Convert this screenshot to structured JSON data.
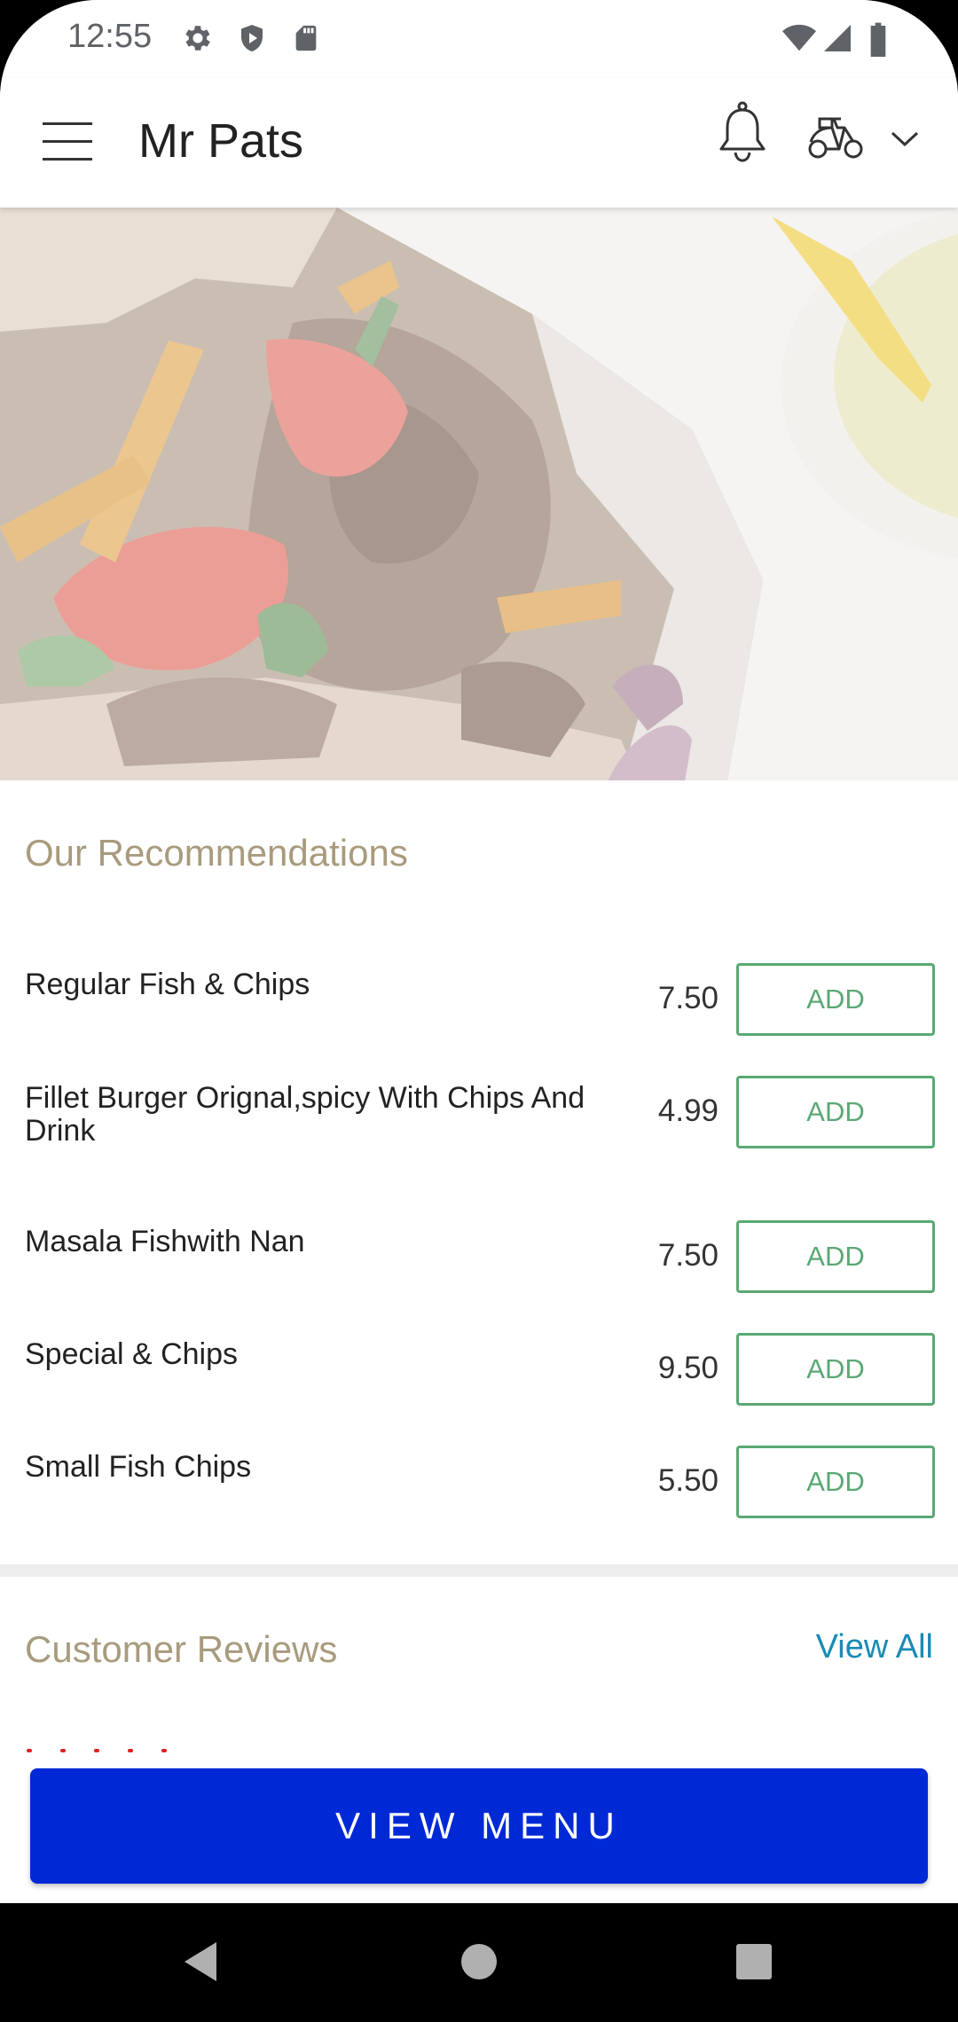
{
  "status_bar": {
    "time": "12:55",
    "icons_left": [
      "gear-icon",
      "shield-icon",
      "sd-card-icon"
    ],
    "icons_right": [
      "wifi-icon",
      "cell-signal-icon",
      "battery-icon"
    ]
  },
  "app_bar": {
    "title": "Mr Pats",
    "icons": [
      "menu-icon",
      "bell-icon",
      "scooter-icon",
      "chevron-down-icon"
    ]
  },
  "recommendations": {
    "title": "Our Recommendations",
    "add_label": "ADD",
    "items": [
      {
        "name": "Regular Fish & Chips",
        "price": "7.50",
        "add_label": "ADD"
      },
      {
        "name": "Fillet Burger Orignal,spicy With Chips And Drink",
        "price": "4.99",
        "add_label": "ADD"
      },
      {
        "name": "Masala Fishwith Nan",
        "price": "7.50",
        "add_label": "ADD"
      },
      {
        "name": "Special & Chips",
        "price": "9.50",
        "add_label": "ADD"
      },
      {
        "name": "Small Fish Chips",
        "price": "5.50",
        "add_label": "ADD"
      }
    ]
  },
  "reviews": {
    "title": "Customer Reviews",
    "view_all": "View All"
  },
  "cta": {
    "view_menu": "VIEW MENU"
  },
  "colors": {
    "accent_title": "#a89b7d",
    "add_green": "#5aa874",
    "link_blue": "#1a8ab5",
    "button_blue": "#0029d6",
    "star_red": "#e02020"
  },
  "nav": {
    "icons": [
      "back-icon",
      "home-icon",
      "recents-icon"
    ]
  }
}
